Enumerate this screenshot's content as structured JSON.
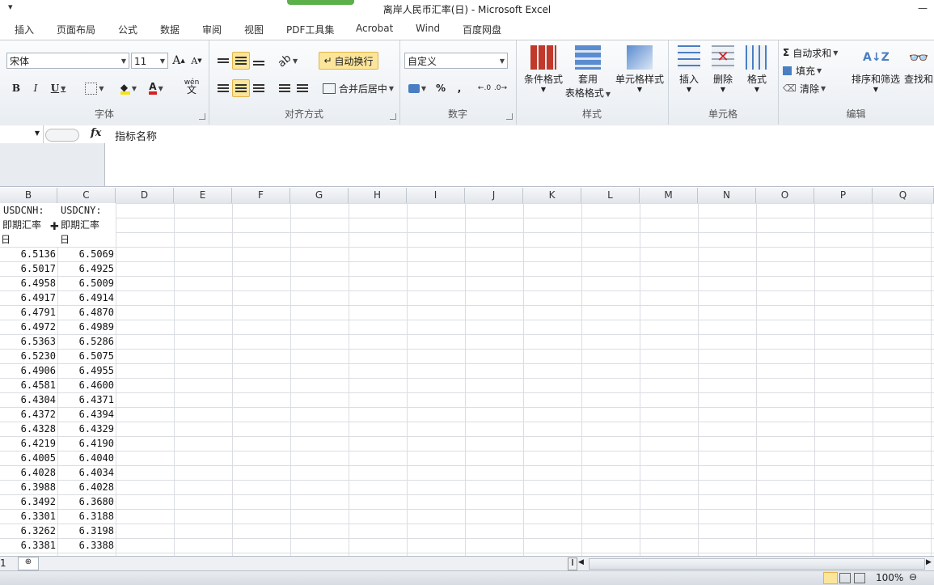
{
  "window": {
    "title": "离岸人民币汇率(日) - Microsoft Excel"
  },
  "tabs": [
    {
      "label": "插入"
    },
    {
      "label": "页面布局"
    },
    {
      "label": "公式"
    },
    {
      "label": "数据"
    },
    {
      "label": "审阅"
    },
    {
      "label": "视图"
    },
    {
      "label": "PDF工具集"
    },
    {
      "label": "Acrobat"
    },
    {
      "label": "Wind"
    },
    {
      "label": "百度网盘"
    }
  ],
  "ribbon": {
    "font": {
      "label": "字体",
      "name": "宋体",
      "size": "11",
      "bold": "B",
      "italic": "I",
      "underline": "U",
      "grow": "A",
      "shrink": "A",
      "color_a": "A",
      "phonetic": "wén"
    },
    "align": {
      "label": "对齐方式",
      "wrap": "自动换行",
      "merge": "合并后居中"
    },
    "number": {
      "label": "数字",
      "format": "自定义",
      "percent": "%",
      "comma": ","
    },
    "styles": {
      "label": "样式",
      "cond": "条件格式",
      "table_1": "套用",
      "table_2": "表格格式",
      "cell": "单元格样式"
    },
    "cells": {
      "label": "单元格",
      "insert": "插入",
      "delete": "删除",
      "format": "格式"
    },
    "edit": {
      "label": "编辑",
      "autosum": "自动求和",
      "fill": "填充",
      "clear": "清除",
      "sort": "排序和筛选",
      "find": "查找和"
    }
  },
  "formula": {
    "fx": "fx",
    "content": "指标名称"
  },
  "columns": [
    "B",
    "C",
    "D",
    "E",
    "F",
    "G",
    "H",
    "I",
    "J",
    "K",
    "L",
    "M",
    "N",
    "O",
    "P",
    "Q"
  ],
  "header_cells": {
    "b_line1": "USDCNH:",
    "b_line2": "即期汇率",
    "b_line3": "日",
    "c_line1": "USDCNY:",
    "c_line2": "即期汇率",
    "c_line3": "日"
  },
  "rows": [
    [
      "6.5136",
      "6.5069"
    ],
    [
      "6.5017",
      "6.4925"
    ],
    [
      "6.4958",
      "6.5009"
    ],
    [
      "6.4917",
      "6.4914"
    ],
    [
      "6.4791",
      "6.4870"
    ],
    [
      "6.4972",
      "6.4989"
    ],
    [
      "6.5363",
      "6.5286"
    ],
    [
      "6.5230",
      "6.5075"
    ],
    [
      "6.4906",
      "6.4955"
    ],
    [
      "6.4581",
      "6.4600"
    ],
    [
      "6.4304",
      "6.4371"
    ],
    [
      "6.4372",
      "6.4394"
    ],
    [
      "6.4328",
      "6.4329"
    ],
    [
      "6.4219",
      "6.4190"
    ],
    [
      "6.4005",
      "6.4040"
    ],
    [
      "6.4028",
      "6.4034"
    ],
    [
      "6.3988",
      "6.4028"
    ],
    [
      "6.3492",
      "6.3680"
    ],
    [
      "6.3301",
      "6.3188"
    ],
    [
      "6.3262",
      "6.3198"
    ],
    [
      "6.3381",
      "6.3388"
    ]
  ],
  "sheetbar": {
    "left_num": "1"
  },
  "status": {
    "zoom": "100%"
  }
}
